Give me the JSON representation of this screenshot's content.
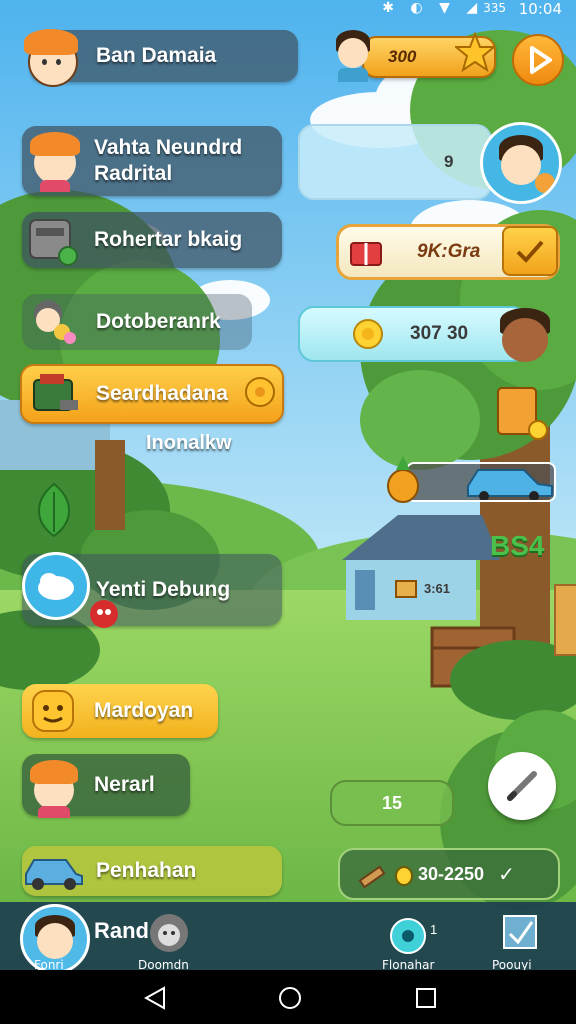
{
  "status": {
    "time": "10:04",
    "battery_label": "335"
  },
  "header": {
    "player_name": "Ban Damaia",
    "coins": "300"
  },
  "menu": [
    {
      "label": "Vahta Neundrd Radrital"
    },
    {
      "label": "Rohertar bkaig"
    },
    {
      "label": "Dotoberanrk"
    },
    {
      "label": "Seardhadana"
    },
    {
      "sublabel": "Inonalkw"
    },
    {
      "label": "Yenti Debung"
    },
    {
      "label": "Mardoyan"
    },
    {
      "label": "Nerarl"
    },
    {
      "label": "Penhahan"
    }
  ],
  "right_panel": {
    "chat_counter": "9",
    "item_count": "9K:Gra",
    "coin_count": "307 30",
    "house_label": "3:61",
    "price_tag": "BS4",
    "small_box": "15",
    "bottom_counter": "30-2250"
  },
  "bottom_bar": {
    "profile_label": "Rand",
    "profile_sub": "Fonri",
    "tab2_label": "Doomdn",
    "tab3_label": "Flonahar",
    "tab4_label": "Poouyi",
    "tab3_badge": "1"
  },
  "colors": {
    "sky": "#7cc8f0",
    "grass": "#7fcc4e",
    "orange_accent": "#f7a51e"
  }
}
